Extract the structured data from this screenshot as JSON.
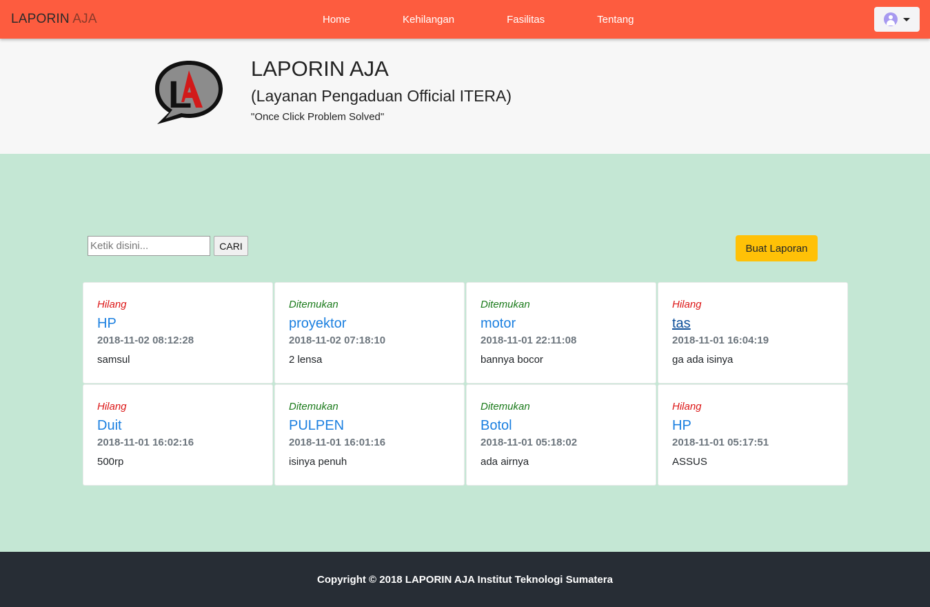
{
  "navbar": {
    "brand_primary": "LAPORIN",
    "brand_accent": "AJA",
    "links": [
      "Home",
      "Kehilangan",
      "Fasilitas",
      "Tentang"
    ]
  },
  "hero": {
    "logo_letters": "LA",
    "title": "LAPORIN AJA",
    "subtitle": "(Layanan Pengaduan Official ITERA)",
    "tagline": "\"Once Click Problem Solved\""
  },
  "search": {
    "placeholder": "Ketik disini...",
    "button_label": "CARI"
  },
  "create_button_label": "Buat Laporan",
  "reports": [
    {
      "status": "Hilang",
      "title": "HP",
      "date": "2018-11-02 08:12:28",
      "desc": "samsul"
    },
    {
      "status": "Ditemukan",
      "title": "proyektor",
      "date": "2018-11-02 07:18:10",
      "desc": "2 lensa"
    },
    {
      "status": "Ditemukan",
      "title": "motor",
      "date": "2018-11-01 22:11:08",
      "desc": "bannya bocor"
    },
    {
      "status": "Hilang",
      "title": "tas",
      "date": "2018-11-01 16:04:19",
      "desc": "ga ada isinya"
    },
    {
      "status": "Hilang",
      "title": "Duit",
      "date": "2018-11-01 16:02:16",
      "desc": "500rp"
    },
    {
      "status": "Ditemukan",
      "title": "PULPEN",
      "date": "2018-11-01 16:01:16",
      "desc": "isinya penuh"
    },
    {
      "status": "Ditemukan",
      "title": "Botol",
      "date": "2018-11-01 05:18:02",
      "desc": "ada airnya"
    },
    {
      "status": "Hilang",
      "title": "HP",
      "date": "2018-11-01 05:17:51",
      "desc": "ASSUS"
    }
  ],
  "footer": {
    "copyright": "Copyright © 2018 LAPORIN AJA Institut Teknologi Sumatera"
  },
  "colors": {
    "navbar": "#fd5c3f",
    "hero_bg": "#f7f7f7",
    "content_bg": "#c4e7d4",
    "lost": "#dc1616",
    "found": "#1a7a1a",
    "link": "#1a7fe0",
    "button_warning": "#ffc107",
    "footer_bg": "#272d35"
  },
  "icons": {
    "user": "user-avatar-icon",
    "dropdown": "chevron-down-icon"
  }
}
